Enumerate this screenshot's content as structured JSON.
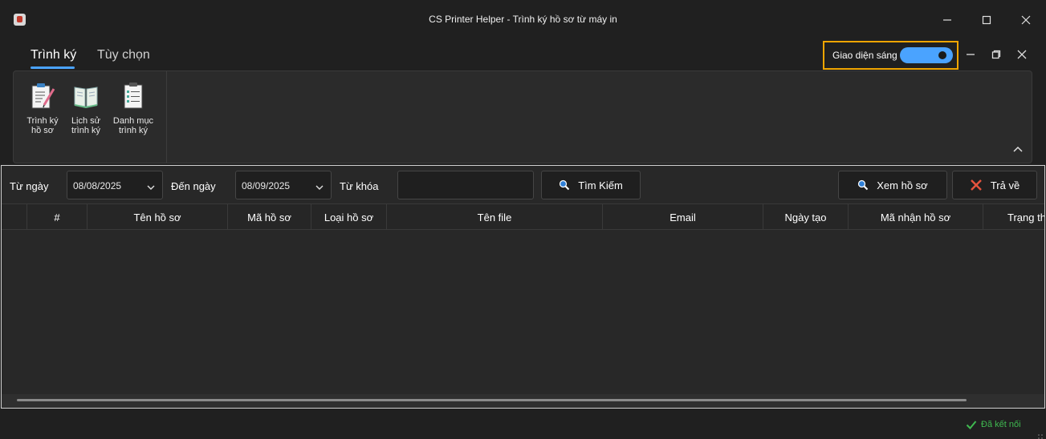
{
  "window": {
    "title": "CS Printer Helper - Trình ký hồ sơ từ máy in"
  },
  "menu": {
    "tabs": [
      {
        "label": "Trình ký",
        "active": true
      },
      {
        "label": "Tùy chọn",
        "active": false
      }
    ]
  },
  "theme_toggle": {
    "label": "Giao diện sáng",
    "on": true,
    "accent": "#4aa3ff",
    "highlight": "#f0a500"
  },
  "ribbon": {
    "items": [
      {
        "label": "Trình ký\nhồ sơ",
        "icon": "sign-document-icon"
      },
      {
        "label": "Lịch sử\ntrình ký",
        "icon": "history-book-icon"
      },
      {
        "label": "Danh mục\ntrình ký",
        "icon": "checklist-icon"
      }
    ]
  },
  "filters": {
    "from_label": "Từ ngày",
    "from_value": "08/08/2025",
    "to_label": "Đến ngày",
    "to_value": "08/09/2025",
    "keyword_label": "Từ khóa",
    "keyword_value": "",
    "search_label": "Tìm Kiếm",
    "view_label": "Xem hồ sơ",
    "return_label": "Trả về"
  },
  "grid": {
    "columns": [
      "",
      "#",
      "Tên hồ sơ",
      "Mã hồ sơ",
      "Loại hồ sơ",
      "Tên file",
      "Email",
      "Ngày tạo",
      "Mã nhận hồ sơ",
      "Trạng thái"
    ],
    "rows": []
  },
  "status": {
    "text": "Đã kết nối",
    "color": "#3fb950"
  }
}
